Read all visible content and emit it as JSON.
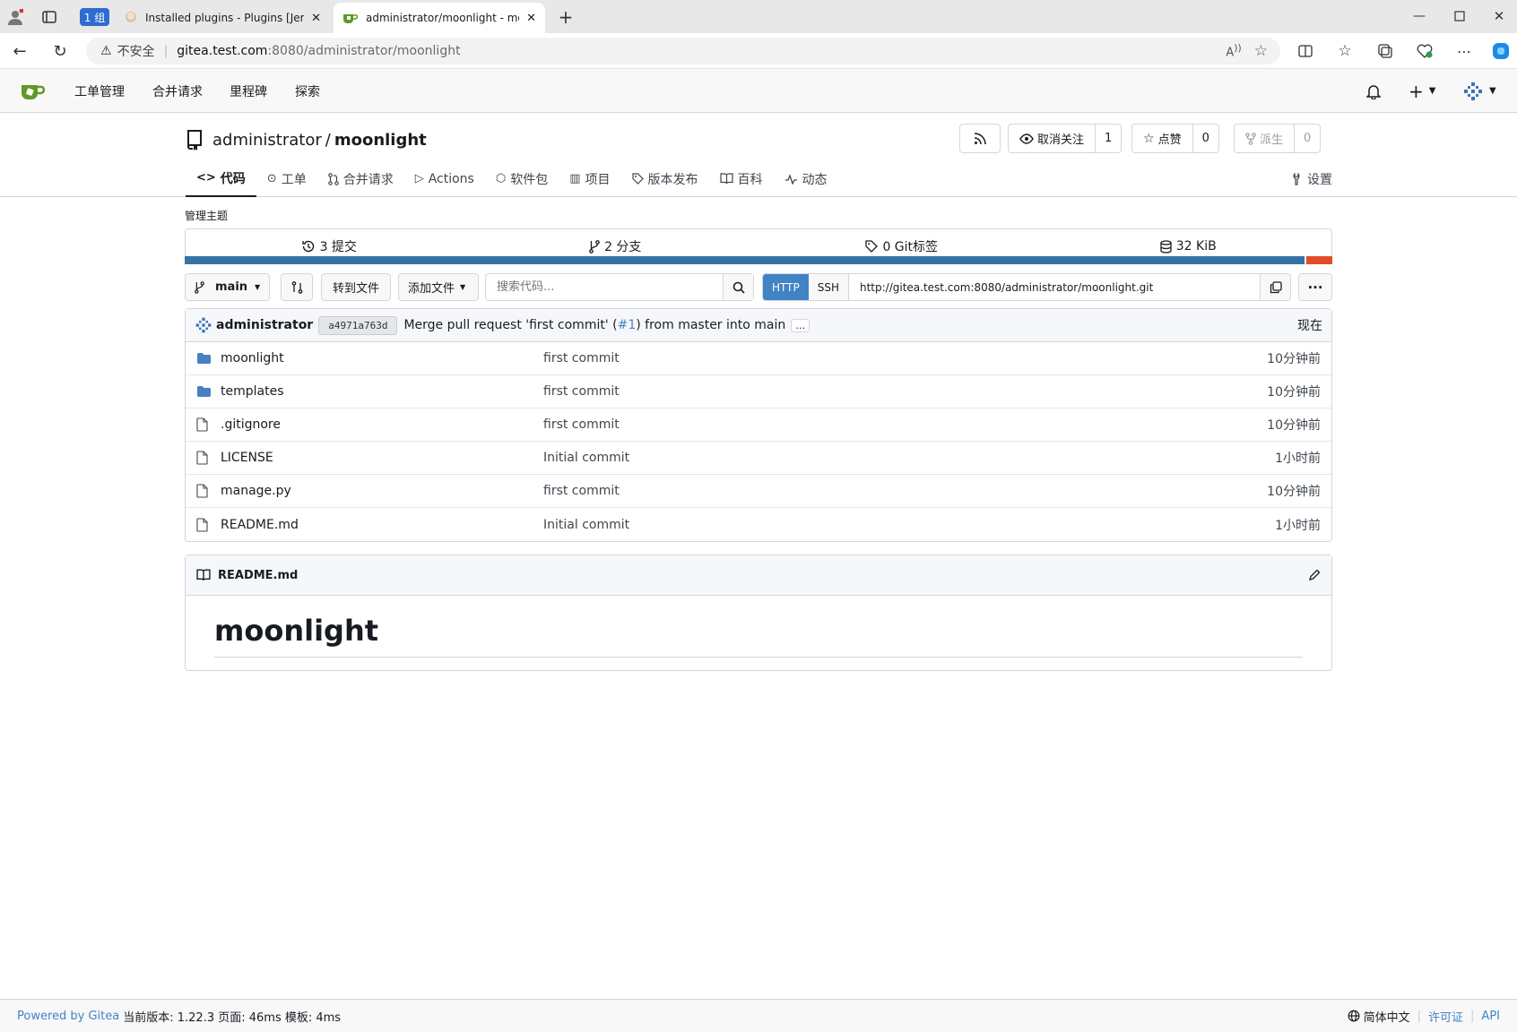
{
  "browser": {
    "group_label": "1 组",
    "tabs": [
      {
        "title": "Installed plugins - Plugins [Jenkins]"
      },
      {
        "title": "administrator/moonlight - moonlight"
      }
    ],
    "url_warning": "不安全",
    "url_host": "gitea.test.com",
    "url_path": ":8080/administrator/moonlight"
  },
  "nav": {
    "items": [
      "工单管理",
      "合并请求",
      "里程碑",
      "探索"
    ]
  },
  "repo": {
    "owner": "administrator",
    "slash": "/",
    "name": "moonlight",
    "watch_label": "取消关注",
    "watch_count": "1",
    "star_label": "点赞",
    "star_count": "0",
    "fork_label": "派生",
    "fork_count": "0",
    "tabs": [
      {
        "icon": "code-icon",
        "label": "代码"
      },
      {
        "icon": "issue-icon",
        "label": "工单"
      },
      {
        "icon": "pull-request-icon",
        "label": "合并请求"
      },
      {
        "icon": "actions-icon",
        "label": "Actions"
      },
      {
        "icon": "package-icon",
        "label": "软件包"
      },
      {
        "icon": "project-icon",
        "label": "项目"
      },
      {
        "icon": "tag-icon",
        "label": "版本发布"
      },
      {
        "icon": "book-icon",
        "label": "百科"
      },
      {
        "icon": "pulse-icon",
        "label": "动态"
      }
    ],
    "settings_label": "设置",
    "manage_topics": "管理主题"
  },
  "stats": {
    "commits": "3 提交",
    "branches": "2 分支",
    "tags": "0 Git标签",
    "size": "32 KiB"
  },
  "languages": [
    {
      "color": "#3572a5",
      "share": 0.977
    },
    {
      "color": "#e34c26",
      "share": 0.023
    }
  ],
  "toolbar": {
    "branch": "main",
    "goto_file": "转到文件",
    "add_file": "添加文件",
    "search_placeholder": "搜索代码...",
    "http": "HTTP",
    "ssh": "SSH",
    "clone_url": "http://gitea.test.com:8080/administrator/moonlight.git"
  },
  "latest_commit": {
    "author": "administrator",
    "sha": "a4971a763d",
    "msg_before": "Merge pull request 'first commit' (",
    "msg_link": "#1",
    "msg_after": ") from master into main",
    "ellipsis": "…",
    "time": "现在"
  },
  "files": [
    {
      "type": "folder",
      "name": "moonlight",
      "message": "first commit",
      "time": "10分钟前"
    },
    {
      "type": "folder",
      "name": "templates",
      "message": "first commit",
      "time": "10分钟前"
    },
    {
      "type": "file",
      "name": ".gitignore",
      "message": "first commit",
      "time": "10分钟前"
    },
    {
      "type": "file",
      "name": "LICENSE",
      "message": "Initial commit",
      "time": "1小时前"
    },
    {
      "type": "file",
      "name": "manage.py",
      "message": "first commit",
      "time": "10分钟前"
    },
    {
      "type": "file",
      "name": "README.md",
      "message": "Initial commit",
      "time": "1小时前"
    }
  ],
  "readme": {
    "filename": "README.md",
    "heading": "moonlight"
  },
  "footer": {
    "powered": "Powered by Gitea",
    "version": "当前版本: 1.22.3 页面: 46ms 模板: 4ms",
    "language": "简体中文",
    "license": "许可证",
    "api": "API"
  }
}
